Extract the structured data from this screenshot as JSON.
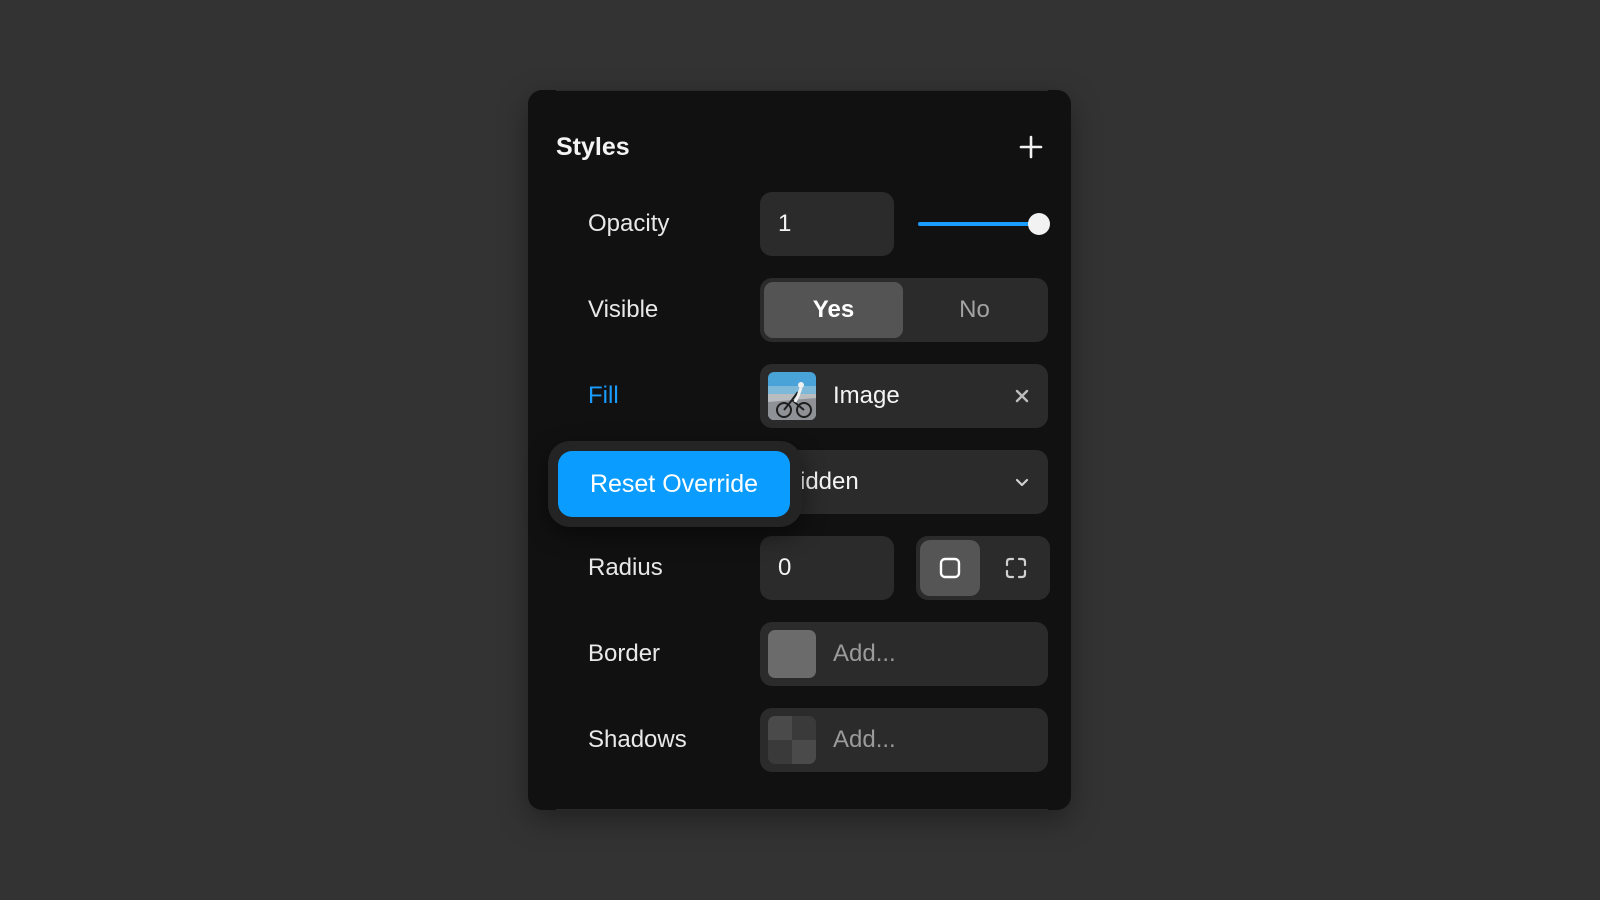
{
  "panel": {
    "title": "Styles",
    "add_icon": "plus-icon"
  },
  "opacity": {
    "label": "Opacity",
    "value": "1",
    "slider_fraction": 1.0,
    "accent": "#1a9cff"
  },
  "visible": {
    "label": "Visible",
    "options": [
      "Yes",
      "No"
    ],
    "selected": "Yes"
  },
  "fill": {
    "label": "Fill",
    "label_color": "#1a9cff",
    "value": "Image",
    "thumbnail": "cyclist-photo",
    "remove_icon": "close-icon"
  },
  "overflow": {
    "visible_text": "idden",
    "chevron_icon": "chevron-down-icon"
  },
  "popover": {
    "button_label": "Reset Override",
    "color": "#0a9cff"
  },
  "radius": {
    "label": "Radius",
    "value": "0",
    "modes": [
      "all-corners-icon",
      "individual-corners-icon"
    ],
    "selected_mode": "all-corners-icon"
  },
  "border": {
    "label": "Border",
    "placeholder": "Add...",
    "swatch_color": "#6b6b6b"
  },
  "shadows": {
    "label": "Shadows",
    "placeholder": "Add..."
  }
}
